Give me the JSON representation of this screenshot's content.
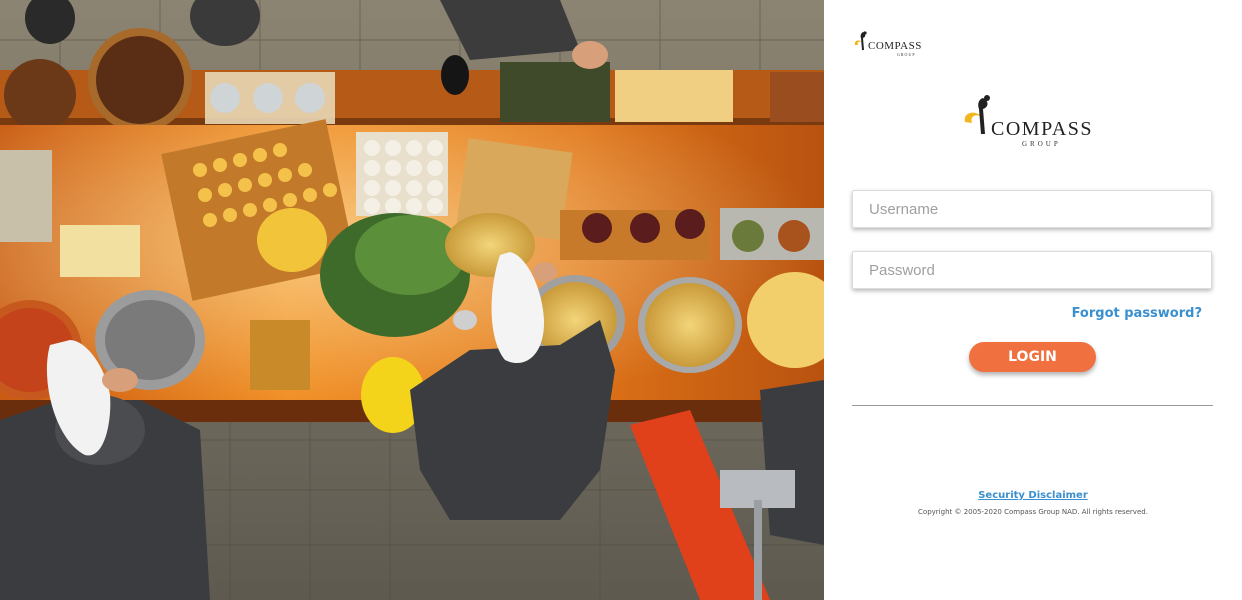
{
  "hero": {
    "description_icon": "catering-buffet-photo"
  },
  "brand": {
    "small_logo_word": "COMPASS",
    "small_logo_sub": "GROUP",
    "big_logo_word": "COMPASS",
    "big_logo_sub": "GROUP",
    "mark_color_yellow": "#f2b71c",
    "mark_color_dark": "#222222"
  },
  "login": {
    "username_placeholder": "Username",
    "password_placeholder": "Password",
    "forgot_label": "Forgot password?",
    "login_label": "LOGIN",
    "button_color": "#f0703f",
    "link_color": "#3a8fcf"
  },
  "footer": {
    "disclaimer_label": "Security Disclaimer",
    "copyright": "Copyright © 2005-2020 Compass Group NAD. All rights reserved."
  }
}
